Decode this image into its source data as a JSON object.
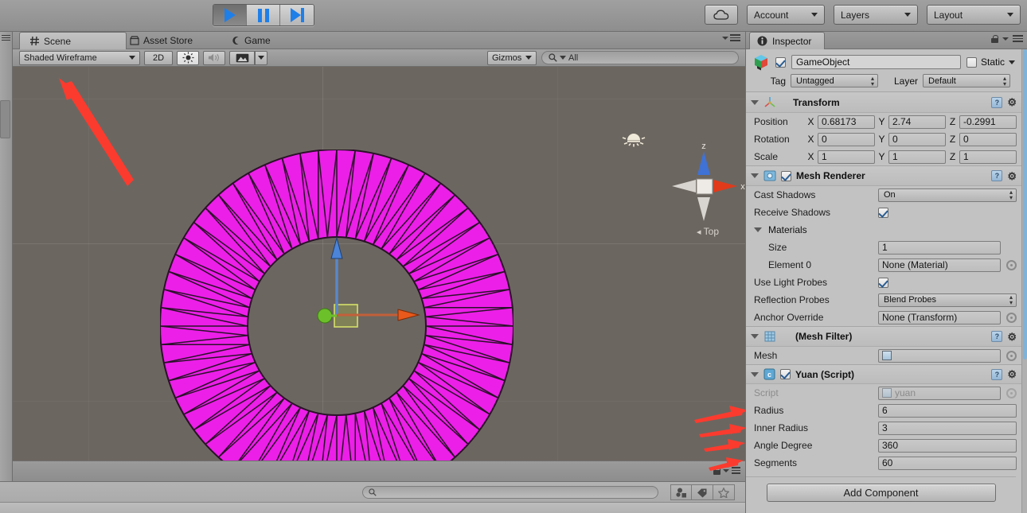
{
  "app": {
    "name": "Unity Editor"
  },
  "toolbar": {
    "play_icon": "play-icon",
    "pause_icon": "pause-icon",
    "step_icon": "step-icon",
    "cloud_label": "",
    "cloud_icon": "cloud-icon",
    "account_label": "Account",
    "layers_label": "Layers",
    "layout_label": "Layout"
  },
  "scene_panel": {
    "tabs": [
      {
        "label": "Scene",
        "icon": "hash-icon",
        "active": true
      },
      {
        "label": "Asset Store",
        "icon": "store-icon",
        "active": false
      },
      {
        "label": "Game",
        "icon": "gamepad-icon",
        "active": false
      }
    ],
    "toolbar": {
      "draw_mode": "Shaded Wireframe",
      "mode_2d": "2D",
      "lighting_icon": "sun-icon",
      "audio_icon": "speaker-icon",
      "effects_icon": "image-icon",
      "gizmos_label": "Gizmos",
      "search_placeholder": "All",
      "search_value": "All",
      "search_icon": "search-icon"
    },
    "viewport": {
      "background_color": "#6c6660",
      "nav_gizmo": {
        "axis_z_label": "z",
        "axis_x_label": "x",
        "view_label": "Top",
        "z_color": "#3f72d4",
        "x_color": "#e03a1b",
        "neutral_color": "#d8d4cf"
      },
      "light_gizmo_icon": "light-icon",
      "transform_gizmo": {
        "y_handle_color": "#6cc02a",
        "z_handle_color": "#4b84d8",
        "x_handle_color": "#e8591b",
        "plane_handle_color": "#c3d455"
      },
      "mesh": {
        "name": "annulus-ring-mesh",
        "fill_color": "#ec1fe8",
        "wireframe_color": "#2a1228",
        "outer_radius_px": 222,
        "inner_radius_px": 112,
        "segments": 60,
        "angle_degree": 360
      },
      "annotations": [
        {
          "name": "arrow-to-draw-mode",
          "target": "Shaded Wireframe"
        },
        {
          "name": "arrow-to-radius",
          "target": "Radius"
        },
        {
          "name": "arrow-to-inner-radius",
          "target": "Inner Radius"
        },
        {
          "name": "arrow-to-angle-degree",
          "target": "Angle Degree"
        },
        {
          "name": "arrow-to-segments",
          "target": "Segments"
        }
      ]
    }
  },
  "project_bar": {
    "search_placeholder": "",
    "search_value": "",
    "search_icon": "search-icon",
    "filter_icons": [
      "asset-filter-icon",
      "label-filter-icon",
      "favorite-filter-icon"
    ]
  },
  "inspector": {
    "tab_label": "Inspector",
    "tab_icon": "info-icon",
    "lock_icon": "lock-icon",
    "menu_icon": "menu-icon",
    "header": {
      "object_icon": "prefab-cube-icon",
      "enabled": true,
      "name": "GameObject",
      "static_label": "Static",
      "static_checked": false,
      "tag_label": "Tag",
      "tag_value": "Untagged",
      "layer_label": "Layer",
      "layer_value": "Default"
    },
    "components": [
      {
        "name": "transform-component",
        "title": "Transform",
        "icon": "transform-axis-icon",
        "expanded": true,
        "rows": [
          {
            "label": "Position",
            "type": "vector3",
            "x": "0.68173",
            "y": "2.74",
            "z": "-0.2991"
          },
          {
            "label": "Rotation",
            "type": "vector3",
            "x": "0",
            "y": "0",
            "z": "0"
          },
          {
            "label": "Scale",
            "type": "vector3",
            "x": "1",
            "y": "1",
            "z": "1"
          }
        ]
      },
      {
        "name": "mesh-renderer-component",
        "title": "Mesh Renderer",
        "icon": "mesh-renderer-icon",
        "enabled": true,
        "expanded": true,
        "rows": [
          {
            "label": "Cast Shadows",
            "type": "dropdown",
            "value": "On"
          },
          {
            "label": "Receive Shadows",
            "type": "checkbox",
            "value": true
          },
          {
            "label": "Materials",
            "type": "foldout",
            "value": ""
          },
          {
            "label": "Size",
            "type": "text",
            "value": "1",
            "indent": true
          },
          {
            "label": "Element 0",
            "type": "object",
            "value": "None (Material)",
            "indent": true
          },
          {
            "label": "Use Light Probes",
            "type": "checkbox",
            "value": true
          },
          {
            "label": "Reflection Probes",
            "type": "dropdown",
            "value": "Blend Probes"
          },
          {
            "label": "Anchor Override",
            "type": "object",
            "value": "None (Transform)"
          }
        ]
      },
      {
        "name": "mesh-filter-component",
        "title": "(Mesh Filter)",
        "icon": "mesh-filter-icon",
        "expanded": true,
        "rows": [
          {
            "label": "Mesh",
            "type": "object",
            "value": ""
          }
        ]
      },
      {
        "name": "yuan-script-component",
        "title": "Yuan (Script)",
        "icon": "script-icon",
        "enabled": true,
        "expanded": true,
        "rows": [
          {
            "label": "Script",
            "type": "object",
            "value": "yuan",
            "disabled": true
          },
          {
            "label": "Radius",
            "type": "text",
            "value": "6"
          },
          {
            "label": "Inner Radius",
            "type": "text",
            "value": "3"
          },
          {
            "label": "Angle Degree",
            "type": "text",
            "value": "360"
          },
          {
            "label": "Segments",
            "type": "text",
            "value": "60"
          }
        ]
      }
    ],
    "add_component_label": "Add Component"
  }
}
